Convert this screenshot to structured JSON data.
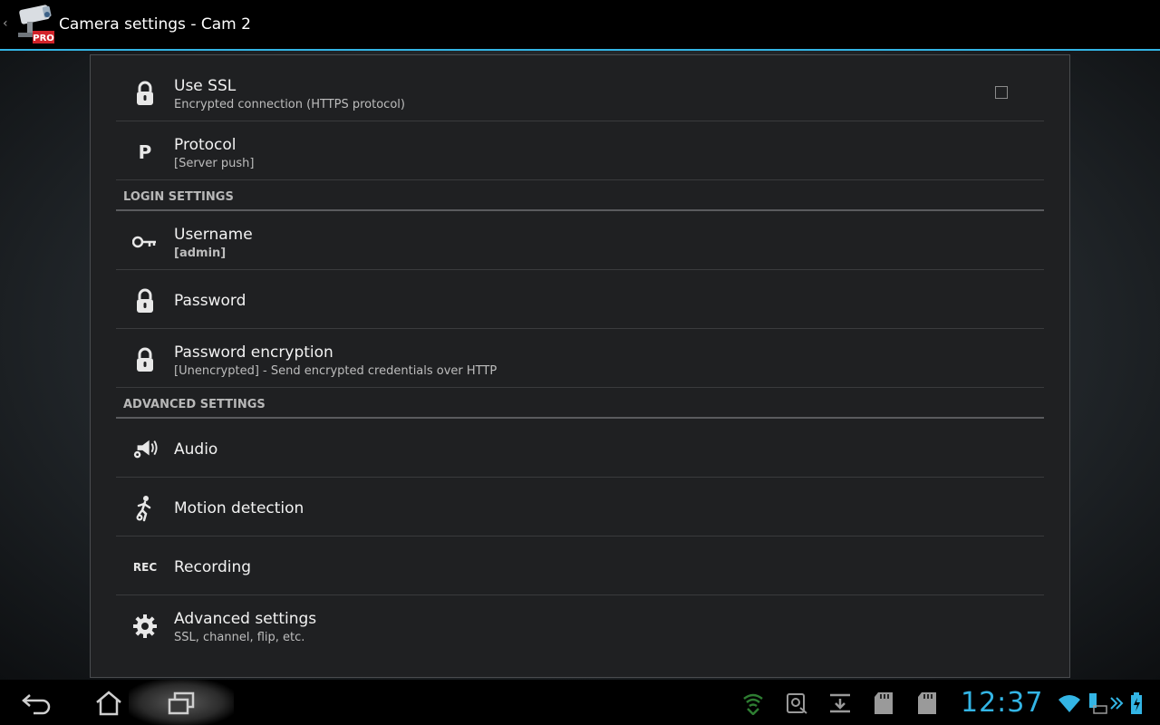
{
  "actionbar": {
    "title": "Camera settings - Cam 2",
    "app_badge": "PRO",
    "up_caret": "‹"
  },
  "settings": {
    "use_ssl": {
      "title": "Use SSL",
      "summary": "Encrypted connection (HTTPS protocol)",
      "checked": false,
      "icon": "lock-icon"
    },
    "protocol": {
      "title": "Protocol",
      "summary": "[Server push]",
      "icon_letter": "P"
    },
    "login_category": "LOGIN SETTINGS",
    "username": {
      "title": "Username",
      "summary": "[admin]",
      "icon": "key-icon"
    },
    "password": {
      "title": "Password",
      "icon": "lock-icon"
    },
    "password_encryption": {
      "title": "Password encryption",
      "summary": "[Unencrypted] - Send encrypted credentials over HTTP",
      "icon": "lock-icon"
    },
    "advanced_category": "ADVANCED SETTINGS",
    "audio": {
      "title": "Audio",
      "icon": "speaker-gear-icon"
    },
    "motion_detection": {
      "title": "Motion detection",
      "icon": "running-man-icon"
    },
    "recording": {
      "title": "Recording",
      "icon_text": "REC"
    },
    "advanced_settings": {
      "title": "Advanced settings",
      "summary": "SSL, channel, flip, etc.",
      "icon": "gear-icon"
    }
  },
  "statusbar": {
    "clock": "12:37",
    "accent_color": "#33b5e5",
    "icons": [
      "shield-icon",
      "usb-debug-icon",
      "download-icon",
      "sdcard-icon",
      "sdcard-icon",
      "wifi-icon",
      "keyboard-battery-icon",
      "more-icon",
      "battery-icon"
    ]
  },
  "navbar": {
    "buttons": [
      "back-icon",
      "home-icon",
      "recent-apps-icon"
    ]
  }
}
